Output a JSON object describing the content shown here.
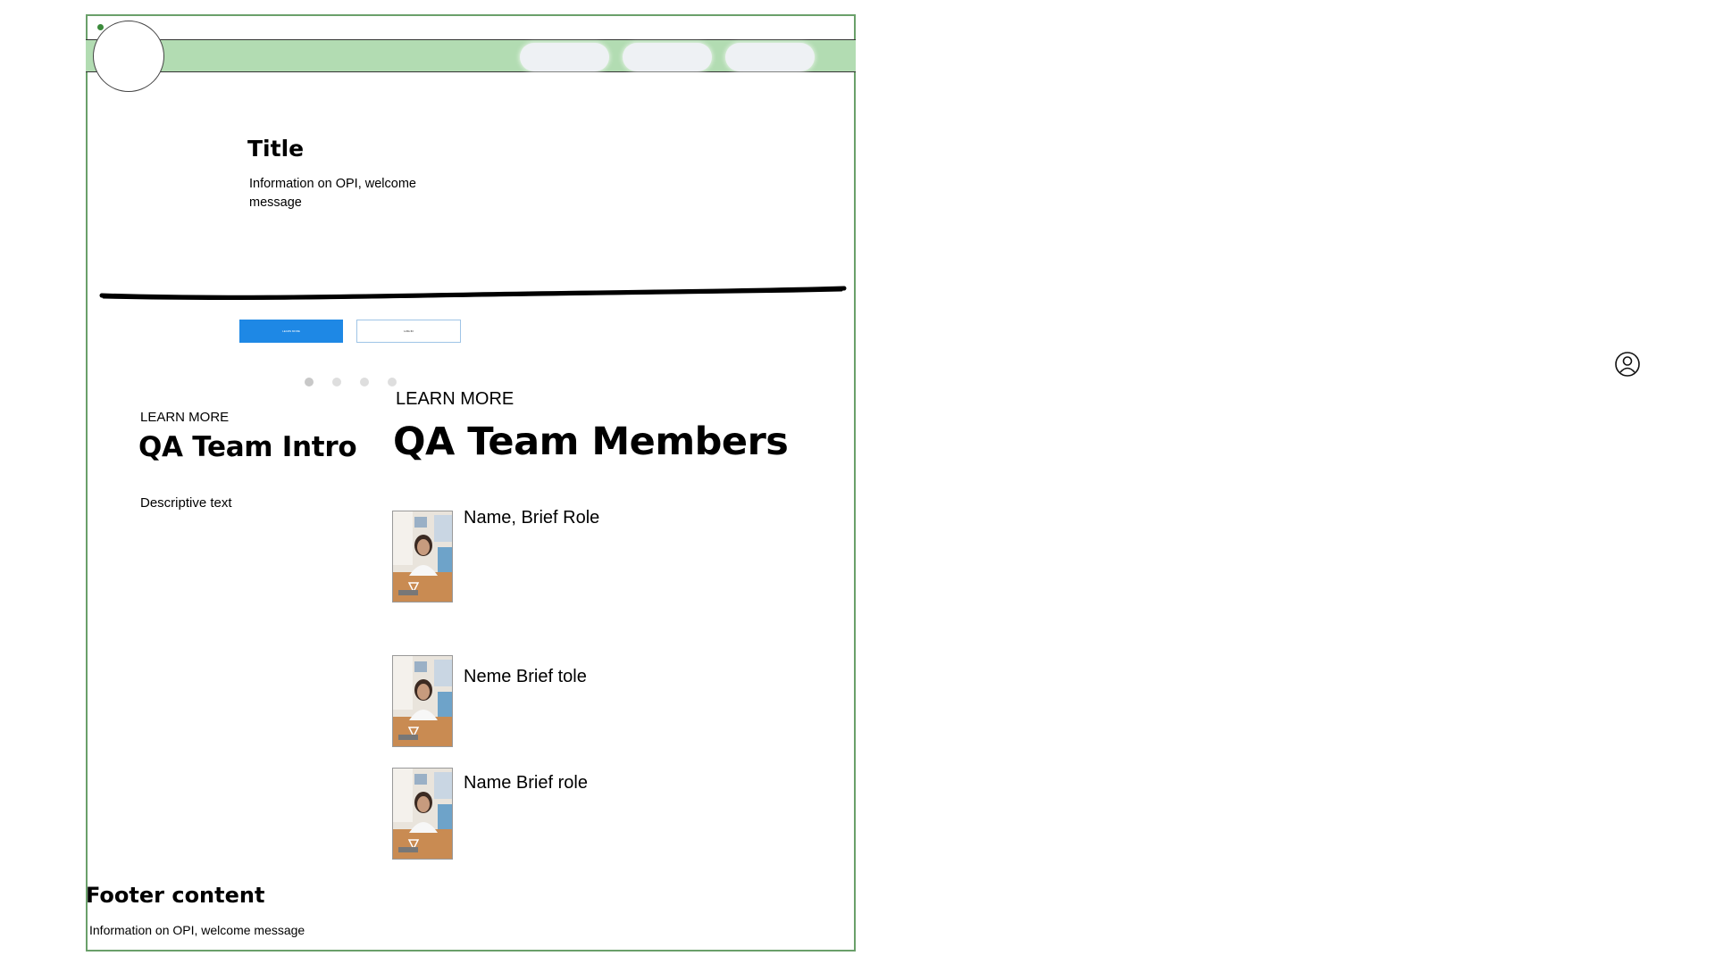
{
  "header": {
    "logo_icon": "circle-logo-icon",
    "nav_items": [
      {
        "label": ""
      },
      {
        "label": ""
      },
      {
        "label": ""
      }
    ],
    "accent_color": "#b2dcb2"
  },
  "hero": {
    "title": "Title",
    "text": "Information on OPI, welcome message",
    "primary_button": "LEARN MORE",
    "secondary_button": "LOG IN",
    "primary_color": "#1e88e5",
    "carousel": {
      "count": 4,
      "active_index": 0
    }
  },
  "intro": {
    "eyebrow": "LEARN MORE",
    "title": "QA Team Intro",
    "text": "Descriptive text"
  },
  "members": {
    "eyebrow": "LEARN MORE",
    "title": "QA Team Members",
    "items": [
      {
        "name": "Name, Brief Role",
        "photo_icon": "member-photo-icon"
      },
      {
        "name": "Neme Brief tole",
        "photo_icon": "member-photo-icon"
      },
      {
        "name": "Name Brief role",
        "photo_icon": "member-photo-icon"
      }
    ]
  },
  "footer": {
    "title": "Footer content",
    "text": "Information on OPI, welcome message"
  },
  "side": {
    "user_icon": "user-account-icon"
  }
}
